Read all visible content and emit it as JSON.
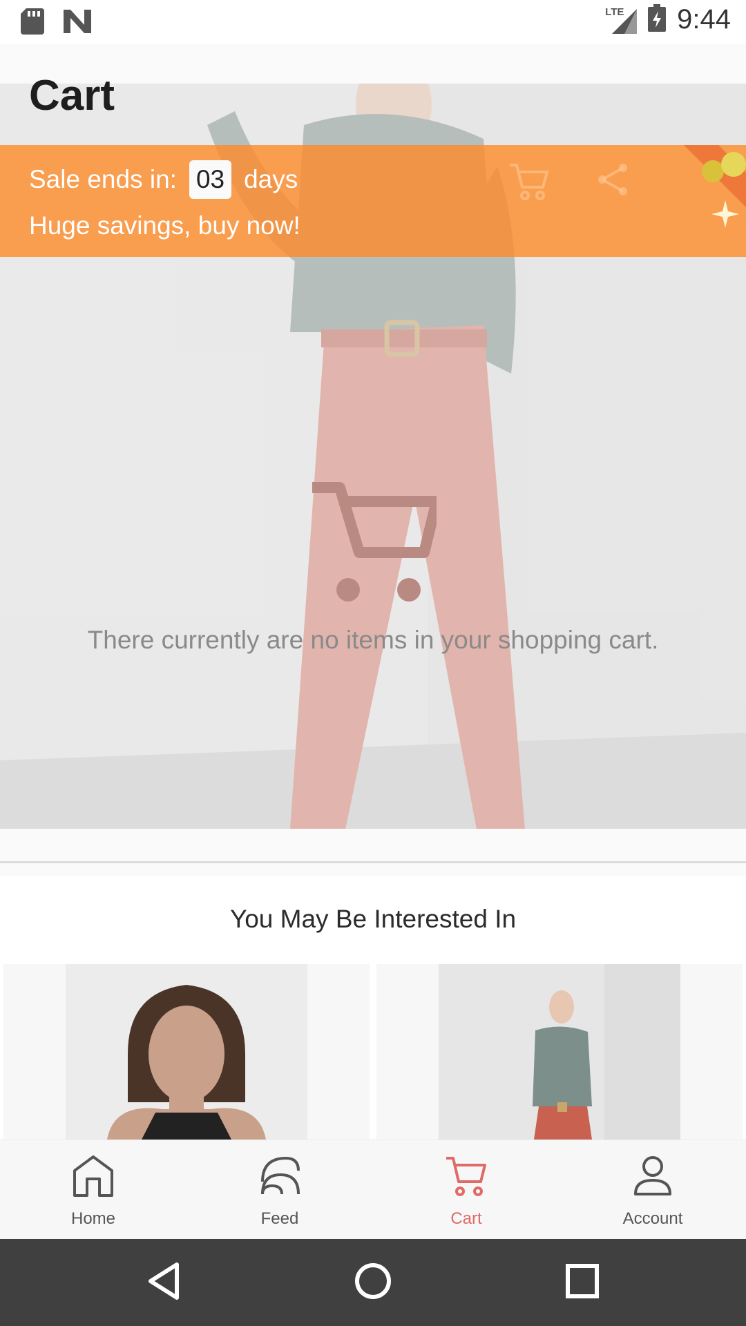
{
  "status_bar": {
    "time": "9:44",
    "network": "LTE"
  },
  "header": {
    "title": "Cart"
  },
  "sale_banner": {
    "prefix": "Sale ends in:",
    "days_value": "03",
    "days_unit": "days",
    "tagline": "Huge savings, buy now!"
  },
  "cart": {
    "empty_message": "There currently are no items in your shopping cart."
  },
  "recommendations": {
    "title": "You May Be Interested In"
  },
  "bottom_nav": {
    "items": [
      {
        "label": "Home",
        "icon": "home-icon"
      },
      {
        "label": "Feed",
        "icon": "feed-icon"
      },
      {
        "label": "Cart",
        "icon": "cart-icon",
        "active": true
      },
      {
        "label": "Account",
        "icon": "account-icon"
      }
    ]
  },
  "colors": {
    "accent": "#E06A66",
    "banner": "#FD8C2D",
    "system_nav": "#404040"
  }
}
